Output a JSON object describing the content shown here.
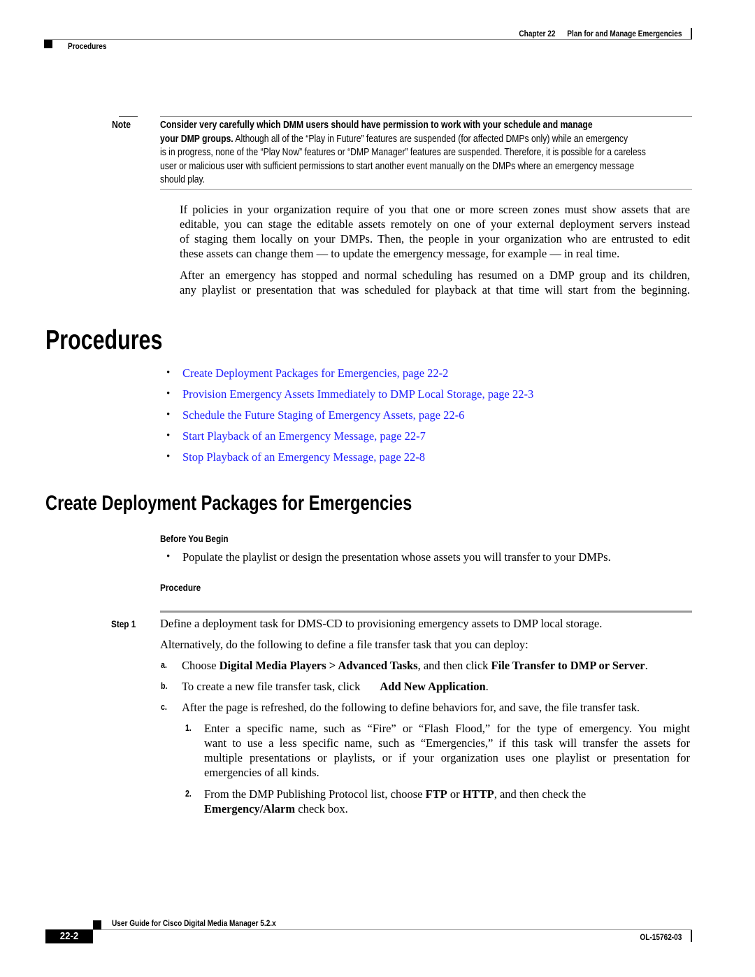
{
  "header": {
    "chapter": "Chapter 22",
    "chapter_title": "Plan for and Manage Emergencies",
    "section": "Procedures"
  },
  "note": {
    "label": "Note",
    "line1_bold": "Consider very carefully which DMM users should have permission to work with your schedule and manage",
    "line2_bold": "your DMP groups.",
    "line2_rest": " Although all of the “Play in Future” features are suspended (for affected DMPs only) while an emergency",
    "line3": "is in progress, none of the “Play Now” features or “DMP Manager” features are suspended. Therefore, it is possible for a careless",
    "line4": "user or malicious user with sufficient permissions to start another event manually on the DMPs where an emergency message",
    "line5": "should play."
  },
  "intro": {
    "paragraph1": [
      "If policies in your organization require of you that one or more screen zones must show assets that are",
      "editable, you can stage the editable assets remotely on one of your external deployment servers instead",
      "of staging them locally on your DMPs. Then, the people in your organization who are entrusted to edit",
      "these assets can change them — to update the emergency message, for example — in real time."
    ],
    "paragraph2": [
      "After an emergency has stopped and normal scheduling has resumed on a DMP group and its children,",
      "any playlist or presentation that was scheduled for playback at that time will start from the beginning."
    ]
  },
  "procedures": {
    "heading": "Procedures",
    "links": [
      "Create Deployment Packages for Emergencies, page 22-2",
      "Provision Emergency Assets Immediately to DMP Local Storage, page 22-3",
      "Schedule the Future Staging of Emergency Assets, page 22-6",
      "Start Playback of an Emergency Message, page 22-7",
      "Stop Playback of an Emergency Message, page 22-8"
    ],
    "link_color": "#1f1fff"
  },
  "section": {
    "heading": "Create Deployment Packages for Emergencies",
    "before_you_begin_label": "Before You Begin",
    "before_you_begin_items": [
      "Populate the playlist or design the presentation whose assets you will transfer to your DMPs."
    ],
    "procedure_label": "Procedure",
    "step1": {
      "label": "Step 1",
      "text": "Define a deployment task for DMS-CD to provisioning emergency assets to DMP local storage.",
      "alternative": "Alternatively, do the following to define a file transfer task that you can deploy:",
      "a": {
        "label": "a.",
        "t1": "Choose ",
        "b1": "Digital Media Players > Advanced Tasks",
        "t2": ", and then click ",
        "b2": "File Transfer to DMP or Server",
        "t3": "."
      },
      "b": {
        "label": "b.",
        "t1": "To create a new file transfer task, click",
        "b1": "Add New Application",
        "t2": "."
      },
      "c": {
        "label": "c.",
        "t1": "After the page is refreshed, do the following to define behaviors for, and save, the file transfer task."
      },
      "sub1": {
        "label": "1.",
        "lines": [
          "Enter a specific name, such as “Fire” or “Flash Flood,” for the type of emergency. You might",
          "want to use a less specific name, such as “Emergencies,” if this task will transfer the assets for",
          "multiple presentations or playlists, or if your organization uses one playlist or presentation for",
          "emergencies of all kinds."
        ]
      },
      "sub2": {
        "label": "2.",
        "t1": "From the DMP Publishing Protocol list, choose ",
        "b1": "FTP",
        "t2": " or ",
        "b2": "HTTP",
        "t3": ", and then check the",
        "b3": "Emergency/Alarm",
        "t4": " check box."
      }
    }
  },
  "footer": {
    "guide_title": "User Guide for Cisco Digital Media Manager 5.2.x",
    "page_number": "22-2",
    "doc_id": "OL-15762-03"
  }
}
